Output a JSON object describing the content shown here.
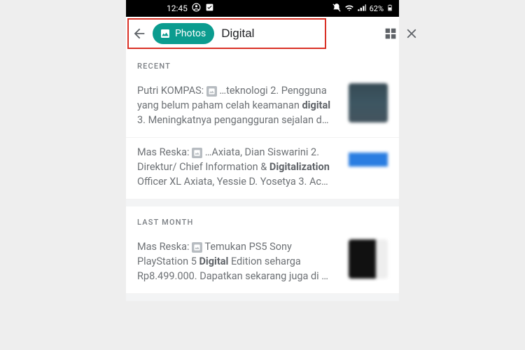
{
  "status": {
    "time": "12:45",
    "battery_text": "62%"
  },
  "search": {
    "chip_label": "Photos",
    "query": "Digital"
  },
  "sections": {
    "recent_label": "RECENT",
    "last_month_label": "LAST MONTH"
  },
  "results": {
    "recent": [
      {
        "sender": "Putri KOMPAS:",
        "pre": " …teknologi 2. Pengguna yang belum paham celah keamanan ",
        "bold": "digital",
        "post": " 3. Meningkatnya pengangguran sejalan d…"
      },
      {
        "sender": "Mas Reska:",
        "pre": " …Axiata, Dian Siswarini 2. Direktur/ Chief Information & ",
        "bold": "Digitalization",
        "post": " Officer XL Axiata, Yessie D. Yosetya 3. Ac…"
      }
    ],
    "last_month": [
      {
        "sender": "Mas Reska:",
        "pre": " Temukan PS5 Sony PlayStation 5 ",
        "bold": "Digital",
        "post": " Edition seharga Rp8.499.000. Dapatkan sekarang juga di …"
      }
    ]
  }
}
